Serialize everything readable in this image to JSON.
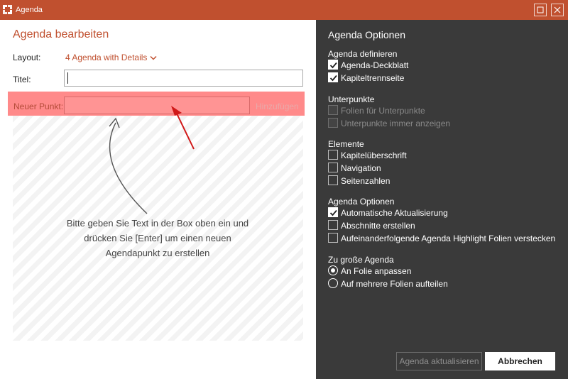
{
  "window": {
    "title": "Agenda"
  },
  "editor": {
    "heading": "Agenda bearbeiten",
    "layout_label": "Layout:",
    "layout_value": "4 Agenda with Details",
    "titel_label": "Titel:",
    "titel_value": "",
    "neuer_label": "Neuer Punkt:",
    "neuer_value": "",
    "add_label": "Hinzufügen",
    "hint_lines": [
      "Bitte geben Sie Text in der Box oben ein und",
      "drücken Sie [Enter] um einen neuen",
      "Agendapunkt zu erstellen"
    ]
  },
  "options": {
    "heading": "Agenda Optionen",
    "groups": [
      {
        "title": "Agenda definieren",
        "items": [
          {
            "label": "Agenda-Deckblatt",
            "checked": true,
            "enabled": true
          },
          {
            "label": "Kapiteltrennseite",
            "checked": true,
            "enabled": true
          }
        ]
      },
      {
        "title": "Unterpunkte",
        "items": [
          {
            "label": "Folien für Unterpunkte",
            "checked": false,
            "enabled": false
          },
          {
            "label": "Unterpunkte immer anzeigen",
            "checked": false,
            "enabled": false
          }
        ]
      },
      {
        "title": "Elemente",
        "items": [
          {
            "label": "Kapitelüberschrift",
            "checked": false,
            "enabled": true
          },
          {
            "label": "Navigation",
            "checked": false,
            "enabled": true
          },
          {
            "label": "Seitenzahlen",
            "checked": false,
            "enabled": true
          }
        ]
      },
      {
        "title": "Agenda Optionen",
        "items": [
          {
            "label": "Automatische Aktualisierung",
            "checked": true,
            "enabled": true
          },
          {
            "label": "Abschnitte erstellen",
            "checked": false,
            "enabled": true
          },
          {
            "label": "Aufeinanderfolgende Agenda Highlight Folien verstecken",
            "checked": false,
            "enabled": true
          }
        ]
      },
      {
        "title": "Zu große Agenda",
        "radios": [
          {
            "label": "An Folie anpassen",
            "selected": true
          },
          {
            "label": "Auf mehrere Folien aufteilen",
            "selected": false
          }
        ]
      }
    ],
    "update_button": "Agenda aktualisieren",
    "cancel_button": "Abbrechen"
  },
  "colors": {
    "accent": "#c0502f",
    "panel_dark": "#3a3a3a",
    "highlight_band": "#ff8a8a",
    "annotation_arrow": "#d01818"
  },
  "icons": {
    "app": "app-logo-icon",
    "maximize": "maximize-icon",
    "close": "close-icon",
    "dropdown": "chevron-down-icon",
    "check": "checkmark-icon"
  }
}
